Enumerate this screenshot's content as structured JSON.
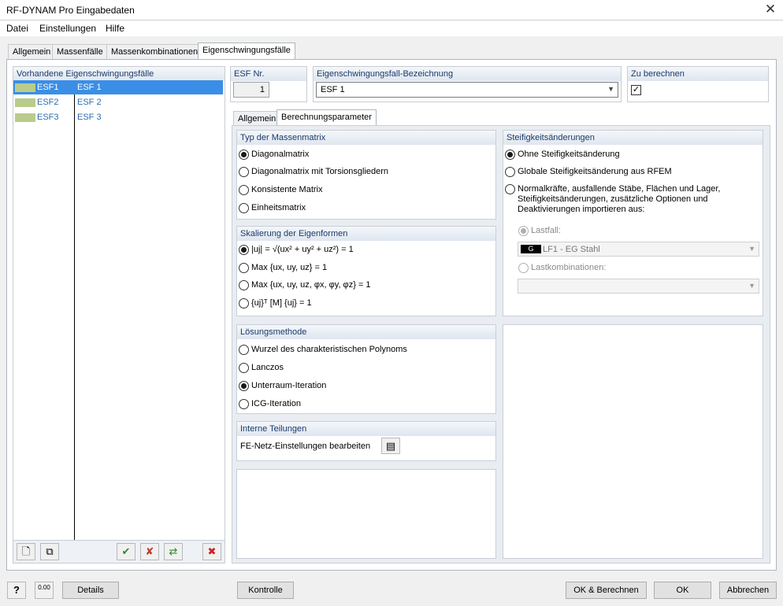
{
  "window": {
    "title": "RF-DYNAM Pro Eingabedaten",
    "close_icon": "close-icon"
  },
  "menu": [
    "Datei",
    "Einstellungen",
    "Hilfe"
  ],
  "tabs": [
    "Allgemein",
    "Massenfälle",
    "Massenkombinationen",
    "Eigenschwingungsfälle"
  ],
  "left": {
    "header": "Vorhandene Eigenschwingungsfälle",
    "items": [
      {
        "id": "ESF1",
        "name": "ESF 1",
        "selected": true
      },
      {
        "id": "ESF2",
        "name": "ESF 2",
        "selected": false
      },
      {
        "id": "ESF3",
        "name": "ESF 3",
        "selected": false
      }
    ],
    "swatch_color": "#b9cc8c"
  },
  "esf_nr": {
    "label": "ESF Nr.",
    "value": "1"
  },
  "bezeichnung": {
    "label": "Eigenschwingungsfall-Bezeichnung",
    "value": "ESF 1"
  },
  "zu_berechnen": {
    "label": "Zu berechnen",
    "checked": true
  },
  "subtabs": [
    "Allgemein",
    "Berechnungsparameter"
  ],
  "massenmatrix": {
    "title": "Typ der Massenmatrix",
    "options": [
      "Diagonalmatrix",
      "Diagonalmatrix mit Torsionsgliedern",
      "Konsistente Matrix",
      "Einheitsmatrix"
    ],
    "selected": 0
  },
  "skalierung": {
    "title": "Skalierung der Eigenformen",
    "options": [
      "|uj| = √(ux² + uy² + uz²) = 1",
      "Max {ux, uy, uz} = 1",
      "Max {ux, uy, uz, φx, φy, φz} = 1",
      "{uj}ᵀ [M] {uj} = 1"
    ],
    "selected": 0
  },
  "loesung": {
    "title": "Lösungsmethode",
    "options": [
      "Wurzel des charakteristischen Polynoms",
      "Lanczos",
      "Unterraum-Iteration",
      "ICG-Iteration"
    ],
    "selected": 2
  },
  "teilungen": {
    "title": "Interne Teilungen",
    "label": "FE-Netz-Einstellungen bearbeiten"
  },
  "steifigkeit": {
    "title": "Steifigkeitsänderungen",
    "options": [
      "Ohne Steifigkeitsänderung",
      "Globale Steifigkeitsänderung aus RFEM",
      "Normalkräfte, ausfallende Stäbe, Flächen und Lager, Steifigkeitsänderungen, zusätzliche Optionen und Deaktivierungen importieren aus:"
    ],
    "selected": 0,
    "lastfall_label": "Lastfall:",
    "lastfall_badge": "G",
    "lastfall_value": "LF1 - EG Stahl",
    "lastkomb_label": "Lastkombinationen:"
  },
  "bottom": {
    "details": "Details",
    "kontrolle": "Kontrolle",
    "ok_berechnen": "OK & Berechnen",
    "ok": "OK",
    "abbrechen": "Abbrechen",
    "calc_value": "0.00"
  }
}
